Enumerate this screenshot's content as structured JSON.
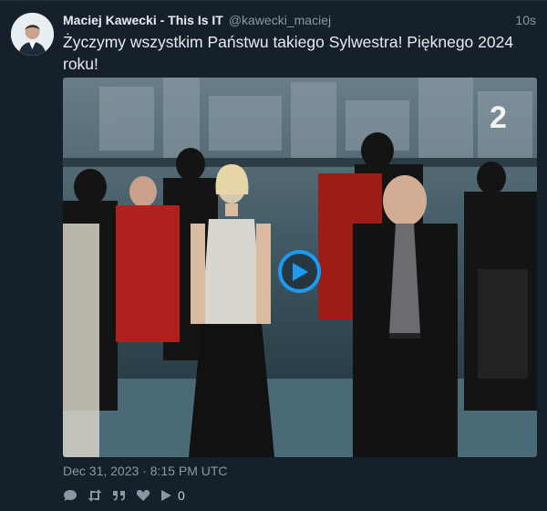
{
  "tweet": {
    "author_name": "Maciej Kawecki - This Is IT",
    "author_handle": "@kawecki_maciej",
    "relative_time": "10s",
    "text": "Życzymy wszystkim Państwu takiego Sylwestra! Pięknego 2024 roku!",
    "timestamp": "Dec 31, 2023 · 8:15 PM UTC"
  },
  "media": {
    "type": "video",
    "channel_logo": "2",
    "play_icon": "play-icon"
  },
  "actions": {
    "reply_icon": "reply-icon",
    "retweet_icon": "retweet-icon",
    "quote_icon": "quote-icon",
    "like_icon": "heart-icon",
    "views_icon": "play-icon",
    "view_count": "0"
  },
  "colors": {
    "background": "#15202b",
    "accent": "#1d9bf0",
    "text": "#e7ecef",
    "muted": "#8a98a5"
  }
}
